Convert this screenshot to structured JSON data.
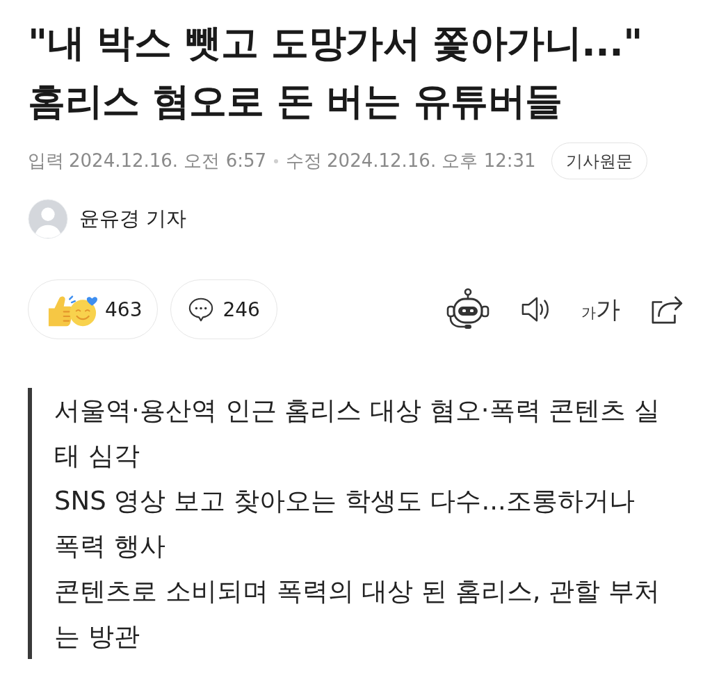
{
  "article": {
    "headline": "\"내 박스 뺏고 도망가서 쫓아가니...\" 홈리스 혐오로 돈 버는 유튜버들",
    "timestamps": [
      {
        "label": "입력",
        "time": "2024.12.16. 오전 6:57"
      },
      {
        "label": "수정",
        "time": "2024.12.16. 오후 12:31"
      }
    ],
    "original_link": "기사원문",
    "author": {
      "name": "윤유경 기자"
    }
  },
  "engagement": [
    {
      "kind": "reaction",
      "count": "463"
    },
    {
      "kind": "comment",
      "count": "246"
    }
  ],
  "tools": [
    {
      "kind": "bot"
    },
    {
      "kind": "audio"
    },
    {
      "kind": "font-size",
      "glyphs": [
        "가",
        "가"
      ]
    },
    {
      "kind": "share"
    }
  ],
  "summary": [
    "서울역·용산역 인근 홈리스 대상 혐오·폭력 콘텐츠 실태 심각",
    "SNS 영상 보고 찾아오는 학생도 다수...조롱하거나 폭력 행사",
    "콘텐츠로 소비되며 폭력의 대상 된 홈리스, 관할 부처는 방관"
  ]
}
